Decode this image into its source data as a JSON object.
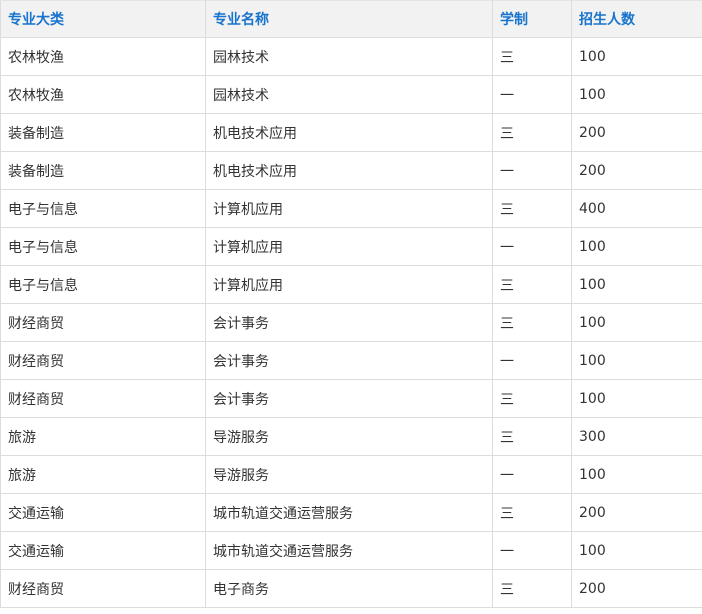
{
  "table": {
    "headers": [
      "专业大类",
      "专业名称",
      "学制",
      "招生人数"
    ],
    "rows": [
      [
        "农林牧渔",
        "园林技术",
        "三",
        "100"
      ],
      [
        "农林牧渔",
        "园林技术",
        "一",
        "100"
      ],
      [
        "装备制造",
        "机电技术应用",
        "三",
        "200"
      ],
      [
        "装备制造",
        "机电技术应用",
        "一",
        "200"
      ],
      [
        "电子与信息",
        "计算机应用",
        "三",
        "400"
      ],
      [
        "电子与信息",
        "计算机应用",
        "一",
        "100"
      ],
      [
        "电子与信息",
        "计算机应用",
        "三",
        "100"
      ],
      [
        "财经商贸",
        "会计事务",
        "三",
        "100"
      ],
      [
        "财经商贸",
        "会计事务",
        "一",
        "100"
      ],
      [
        "财经商贸",
        "会计事务",
        "三",
        "100"
      ],
      [
        "旅游",
        "导游服务",
        "三",
        "300"
      ],
      [
        "旅游",
        "导游服务",
        "一",
        "100"
      ],
      [
        "交通运输",
        "城市轨道交通运营服务",
        "三",
        "200"
      ],
      [
        "交通运输",
        "城市轨道交通运营服务",
        "一",
        "100"
      ],
      [
        "财经商贸",
        "电子商务",
        "三",
        "200"
      ]
    ]
  },
  "colors": {
    "header_text": "#1874cd",
    "header_bg": "#f2f2f2",
    "border": "#dcdcdc",
    "cell_text": "#333333"
  }
}
